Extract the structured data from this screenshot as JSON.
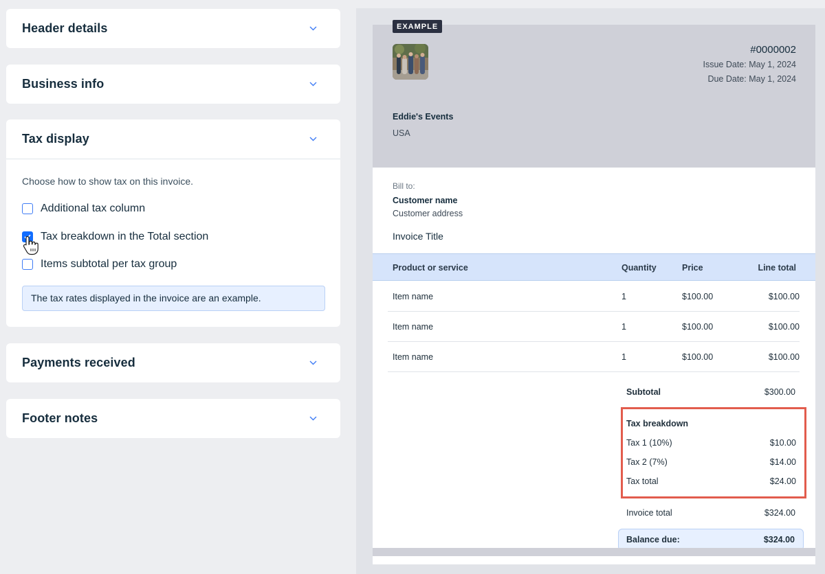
{
  "sections": {
    "header_details": "Header details",
    "business_info": "Business info",
    "tax_display": "Tax display",
    "payments_received": "Payments received",
    "footer_notes": "Footer notes"
  },
  "tax_display": {
    "description": "Choose how to show tax on this invoice.",
    "options": [
      {
        "label": "Additional tax column",
        "checked": false
      },
      {
        "label": "Tax breakdown in the Total section",
        "checked": true
      },
      {
        "label": "Items subtotal per tax group",
        "checked": false
      }
    ],
    "note": "The tax rates displayed in the invoice are an example."
  },
  "invoice": {
    "tag": "EXAMPLE",
    "number": "#0000002",
    "issue_date": "Issue Date: May 1, 2024",
    "due_date": "Due Date: May 1, 2024",
    "business_name": "Eddie's Events",
    "business_country": "USA",
    "bill_to_label": "Bill to:",
    "customer_name": "Customer name",
    "customer_address": "Customer address",
    "title": "Invoice Title",
    "columns": {
      "product": "Product or service",
      "quantity": "Quantity",
      "price": "Price",
      "line_total": "Line total"
    },
    "items": [
      {
        "name": "Item name",
        "quantity": "1",
        "price": "$100.00",
        "total": "$100.00"
      },
      {
        "name": "Item name",
        "quantity": "1",
        "price": "$100.00",
        "total": "$100.00"
      },
      {
        "name": "Item name",
        "quantity": "1",
        "price": "$100.00",
        "total": "$100.00"
      }
    ],
    "subtotal_label": "Subtotal",
    "subtotal_value": "$300.00",
    "tax_breakdown_label": "Tax breakdown",
    "taxes": [
      {
        "label": "Tax 1 (10%)",
        "value": "$10.00"
      },
      {
        "label": "Tax 2 (7%)",
        "value": "$14.00"
      }
    ],
    "tax_total_label": "Tax total",
    "tax_total_value": "$24.00",
    "invoice_total_label": "Invoice total",
    "invoice_total_value": "$324.00",
    "balance_due_label": "Balance due:",
    "balance_due_value": "$324.00"
  },
  "colors": {
    "accent": "#116dff",
    "highlight_border": "#e25c4d",
    "invoice_header_bg": "#cfd0d8",
    "table_header_bg": "#d6e4fb"
  }
}
